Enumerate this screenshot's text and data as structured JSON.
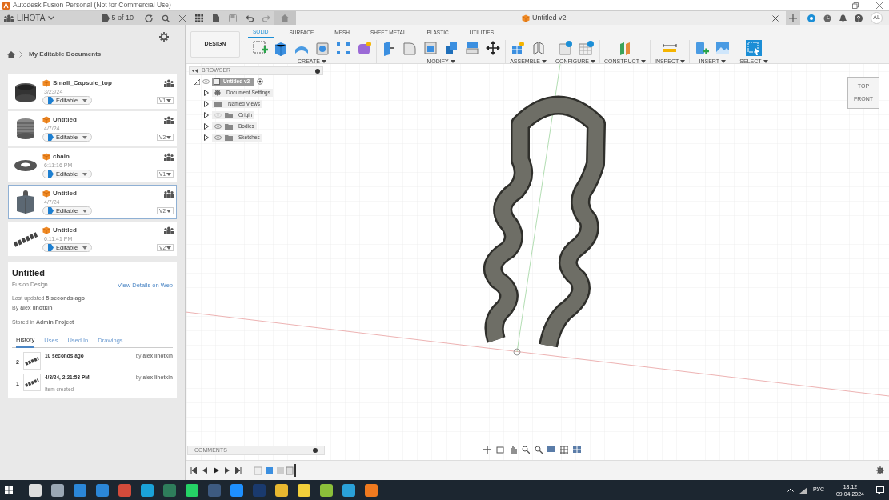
{
  "window": {
    "title": "Autodesk Fusion Personal (Not for Commercial Use)"
  },
  "top_bar": {
    "team": "LIHOTA",
    "document_count": "5 of 10"
  },
  "document_tab": {
    "title": "Untitled v2"
  },
  "user": {
    "initials": "AL"
  },
  "data_panel": {
    "breadcrumb": "My Editable Documents",
    "documents": [
      {
        "name": "Small_Capsule_top",
        "date": "3/23/24",
        "status": "Editable",
        "version": "V1",
        "selected": false
      },
      {
        "name": "Untitled",
        "date": "4/7/24",
        "status": "Editable",
        "version": "V2",
        "selected": false
      },
      {
        "name": "chain",
        "date": "6:11:16 PM",
        "status": "Editable",
        "version": "V1",
        "selected": false
      },
      {
        "name": "Untitled",
        "date": "4/7/24",
        "status": "Editable",
        "version": "V2",
        "selected": true
      },
      {
        "name": "Untitled",
        "date": "6:11:41 PM",
        "status": "Editable",
        "version": "V2",
        "selected": false
      }
    ]
  },
  "details": {
    "title": "Untitled",
    "type": "Fusion Design",
    "link": "View Details on Web",
    "last_updated": "Last updated **5 seconds ago**",
    "author": "By **alex lihotkin**",
    "stored": "Stored in **Admin Project**",
    "tabs": [
      {
        "label": "History",
        "selected": true
      },
      {
        "label": "Uses",
        "selected": false
      },
      {
        "label": "Used In",
        "selected": false
      },
      {
        "label": "Drawings",
        "selected": false
      }
    ],
    "history": [
      {
        "number": "2",
        "time": "10 seconds ago",
        "author": "by **alex lihotkin**"
      },
      {
        "number": "1",
        "time": "4/3/24, 2:21:53 PM",
        "author": "by **alex lihotkin**",
        "note": "Item created"
      }
    ]
  },
  "toolbar": {
    "workspace": "DESIGN",
    "tabs": [
      {
        "label": "SOLID",
        "selected": true
      },
      {
        "label": "SURFACE",
        "selected": false
      },
      {
        "label": "MESH",
        "selected": false
      },
      {
        "label": "SHEET METAL",
        "selected": false
      },
      {
        "label": "PLASTIC",
        "selected": false
      },
      {
        "label": "UTILITIES",
        "selected": false
      }
    ],
    "groups": [
      {
        "label": "CREATE"
      },
      {
        "label": "MODIFY"
      },
      {
        "label": "ASSEMBLE"
      },
      {
        "label": "CONFIGURE"
      },
      {
        "label": "CONSTRUCT"
      },
      {
        "label": "INSPECT"
      },
      {
        "label": "INSERT"
      },
      {
        "label": "SELECT"
      }
    ]
  },
  "browser": {
    "title": "BROWSER",
    "root": "Untitled v2",
    "items": [
      {
        "kind": "settings",
        "label": "Document Settings"
      },
      {
        "kind": "views",
        "label": "Named Views"
      },
      {
        "kind": "folder",
        "label": "Origin",
        "visible": false
      },
      {
        "kind": "folder",
        "label": "Bodies",
        "visible": true
      },
      {
        "kind": "folder",
        "label": "Sketches",
        "visible": true
      }
    ]
  },
  "view_cube": {
    "top": "TOP",
    "front": "FRONT"
  },
  "comments": {
    "title": "COMMENTS"
  },
  "taskbar": {
    "language": "РУС",
    "time": "18:12",
    "date": "09.04.2024"
  }
}
